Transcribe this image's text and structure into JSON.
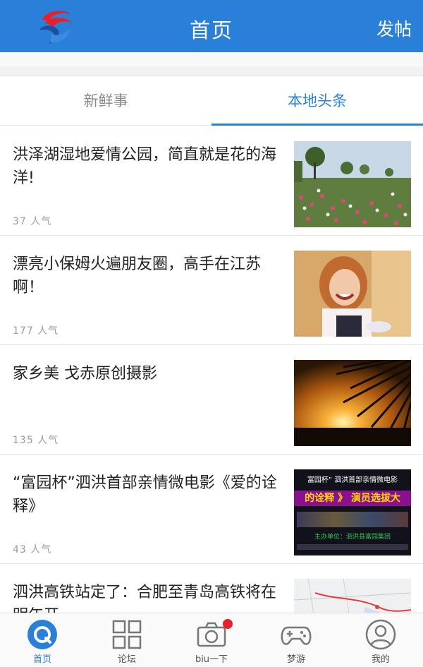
{
  "header": {
    "title": "首页",
    "post_label": "发帖",
    "bg_color": "#2a7fd8"
  },
  "tabs": [
    {
      "label": "新鲜事",
      "active": false
    },
    {
      "label": "本地头条",
      "active": true
    }
  ],
  "articles": [
    {
      "title": "洪泽湖湿地爱情公园，简直就是花的海洋!",
      "views": "37 人气",
      "thumb": "flower-field-photo"
    },
    {
      "title": "漂亮小保姆火遍朋友圈，高手在江苏啊！",
      "views": "177 人气",
      "thumb": "smiling-woman-photo"
    },
    {
      "title": "家乡美  戈赤原创摄影",
      "views": "135 人气",
      "thumb": "sunset-palm-photo"
    },
    {
      "title": "“富园杯”泗洪首部亲情微电影《爱的诠释》",
      "views": "43 人气",
      "thumb": "movie-poster-photo"
    },
    {
      "title": "泗洪高铁站定了：合肥至青岛高铁将在明年开",
      "views": "",
      "thumb": "railway-map-photo"
    }
  ],
  "poster": {
    "line1": "富园杯” 泗洪首部亲情微电影",
    "line2": "的诠释 》 演员选拔大",
    "line3": "主办单位：泗洪县富园集团"
  },
  "nav": [
    {
      "label": "首页",
      "icon": "home-icon",
      "active": true
    },
    {
      "label": "论坛",
      "icon": "grid-icon",
      "active": false
    },
    {
      "label": "biu一下",
      "icon": "camera-icon",
      "active": false
    },
    {
      "label": "梦游",
      "icon": "gamepad-icon",
      "active": false
    },
    {
      "label": "我的",
      "icon": "user-icon",
      "active": false
    }
  ],
  "colors": {
    "accent": "#2a7fd8",
    "badge": "#e8202a"
  }
}
